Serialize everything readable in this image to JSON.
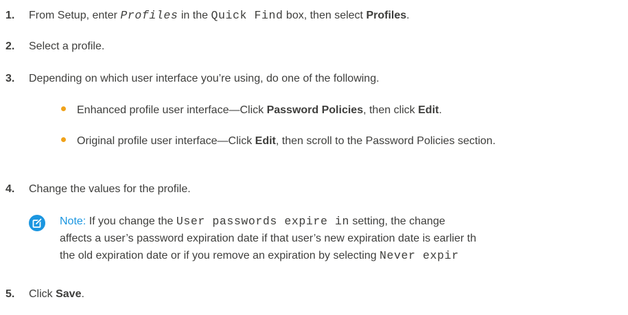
{
  "steps": [
    {
      "num": "1.",
      "p1": "From Setup, enter ",
      "code1": "Profiles",
      "p2": " in the ",
      "code2": "Quick Find",
      "p3": " box, then select ",
      "bold1": "Profiles",
      "p4": "."
    },
    {
      "num": "2.",
      "text": "Select a profile."
    },
    {
      "num": "3.",
      "text": "Depending on which user interface you’re using, do one of the following."
    },
    {
      "num": "4.",
      "text": "Change the values for the profile."
    },
    {
      "num": "5.",
      "p1": "Click ",
      "bold1": "Save",
      "p2": "."
    }
  ],
  "bullets": [
    {
      "p1": "Enhanced profile user interface—Click ",
      "bold1": "Password Policies",
      "p2": ", then click ",
      "bold2": "Edit",
      "p3": "."
    },
    {
      "p1": "Original profile user interface—Click ",
      "bold1": "Edit",
      "p2": ", then scroll to the Password Policies section."
    }
  ],
  "note": {
    "icon": "edit-note-icon",
    "icon_color": "#1b96e0",
    "label": "Note:",
    "l1a": " If you change the ",
    "l1code": "User passwords expire in",
    "l1b": " setting, the change",
    "l2": "affects a user’s password expiration date if that user’s new expiration date is earlier th",
    "l3a": "the old expiration date or if you remove an expiration by selecting ",
    "l3code": "Never expir"
  },
  "colors": {
    "text": "#3e3e3c",
    "bullet": "#f0a21a",
    "note_accent": "#1b96e0"
  }
}
